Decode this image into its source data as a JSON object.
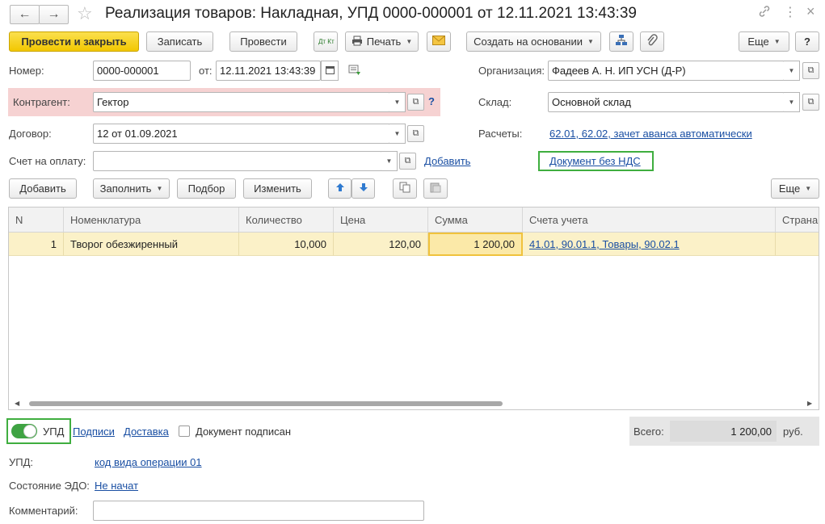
{
  "window": {
    "title": "Реализация товаров: Накладная, УПД 0000-000001 от 12.11.2021 13:43:39",
    "back_icon": "←",
    "forward_icon": "→",
    "more_icon": "⋮",
    "close_icon": "×"
  },
  "toolbar": {
    "post_close": "Провести и закрыть",
    "save": "Записать",
    "post": "Провести",
    "dt_kt": "Дт Кт",
    "print": "Печать",
    "create_based": "Создать на основании",
    "more": "Еще",
    "help": "?"
  },
  "header": {
    "number_label": "Номер:",
    "number_value": "0000-000001",
    "date_label": "от:",
    "date_value": "12.11.2021 13:43:39",
    "org_label": "Организация:",
    "org_value": "Фадеев А. Н. ИП УСН (Д-Р)",
    "counterparty_label": "Контрагент:",
    "counterparty_value": "Гектор",
    "warehouse_label": "Склад:",
    "warehouse_value": "Основной склад",
    "contract_label": "Договор:",
    "contract_value": "12 от 01.09.2021",
    "settlements_label": "Расчеты:",
    "settlements_link": "62.01, 62.02, зачет аванса автоматически",
    "invoice_label": "Счет на оплату:",
    "invoice_value": "",
    "add_link": "Добавить",
    "no_vat_link": "Документ без НДС"
  },
  "table_toolbar": {
    "add": "Добавить",
    "fill": "Заполнить",
    "pick": "Подбор",
    "change": "Изменить",
    "more": "Еще"
  },
  "table": {
    "columns": [
      "N",
      "Номенклатура",
      "Количество",
      "Цена",
      "Сумма",
      "Счета учета",
      "Страна"
    ],
    "rows": [
      {
        "n": "1",
        "item": "Творог обезжиренный",
        "qty": "10,000",
        "price": "120,00",
        "sum": "1 200,00",
        "accounts": "41.01, 90.01.1, Товары, 90.02.1",
        "country": ""
      }
    ]
  },
  "footer": {
    "upd_toggle_label": "УПД",
    "signatures_link": "Подписи",
    "delivery_link": "Доставка",
    "doc_signed_label": "Документ подписан",
    "total_label": "Всего:",
    "total_value": "1 200,00",
    "currency": "руб.",
    "upd_label": "УПД:",
    "upd_link": "код вида операции 01",
    "edo_label": "Состояние ЭДО:",
    "edo_link": "Не начат",
    "comment_label": "Комментарий:",
    "comment_value": ""
  },
  "colors": {
    "primary_button": "#f2c700",
    "link": "#1a4fa3",
    "highlight_row": "#fbf1c8",
    "toggle_on": "#3fa343",
    "required_bg": "#f6d2d2"
  }
}
